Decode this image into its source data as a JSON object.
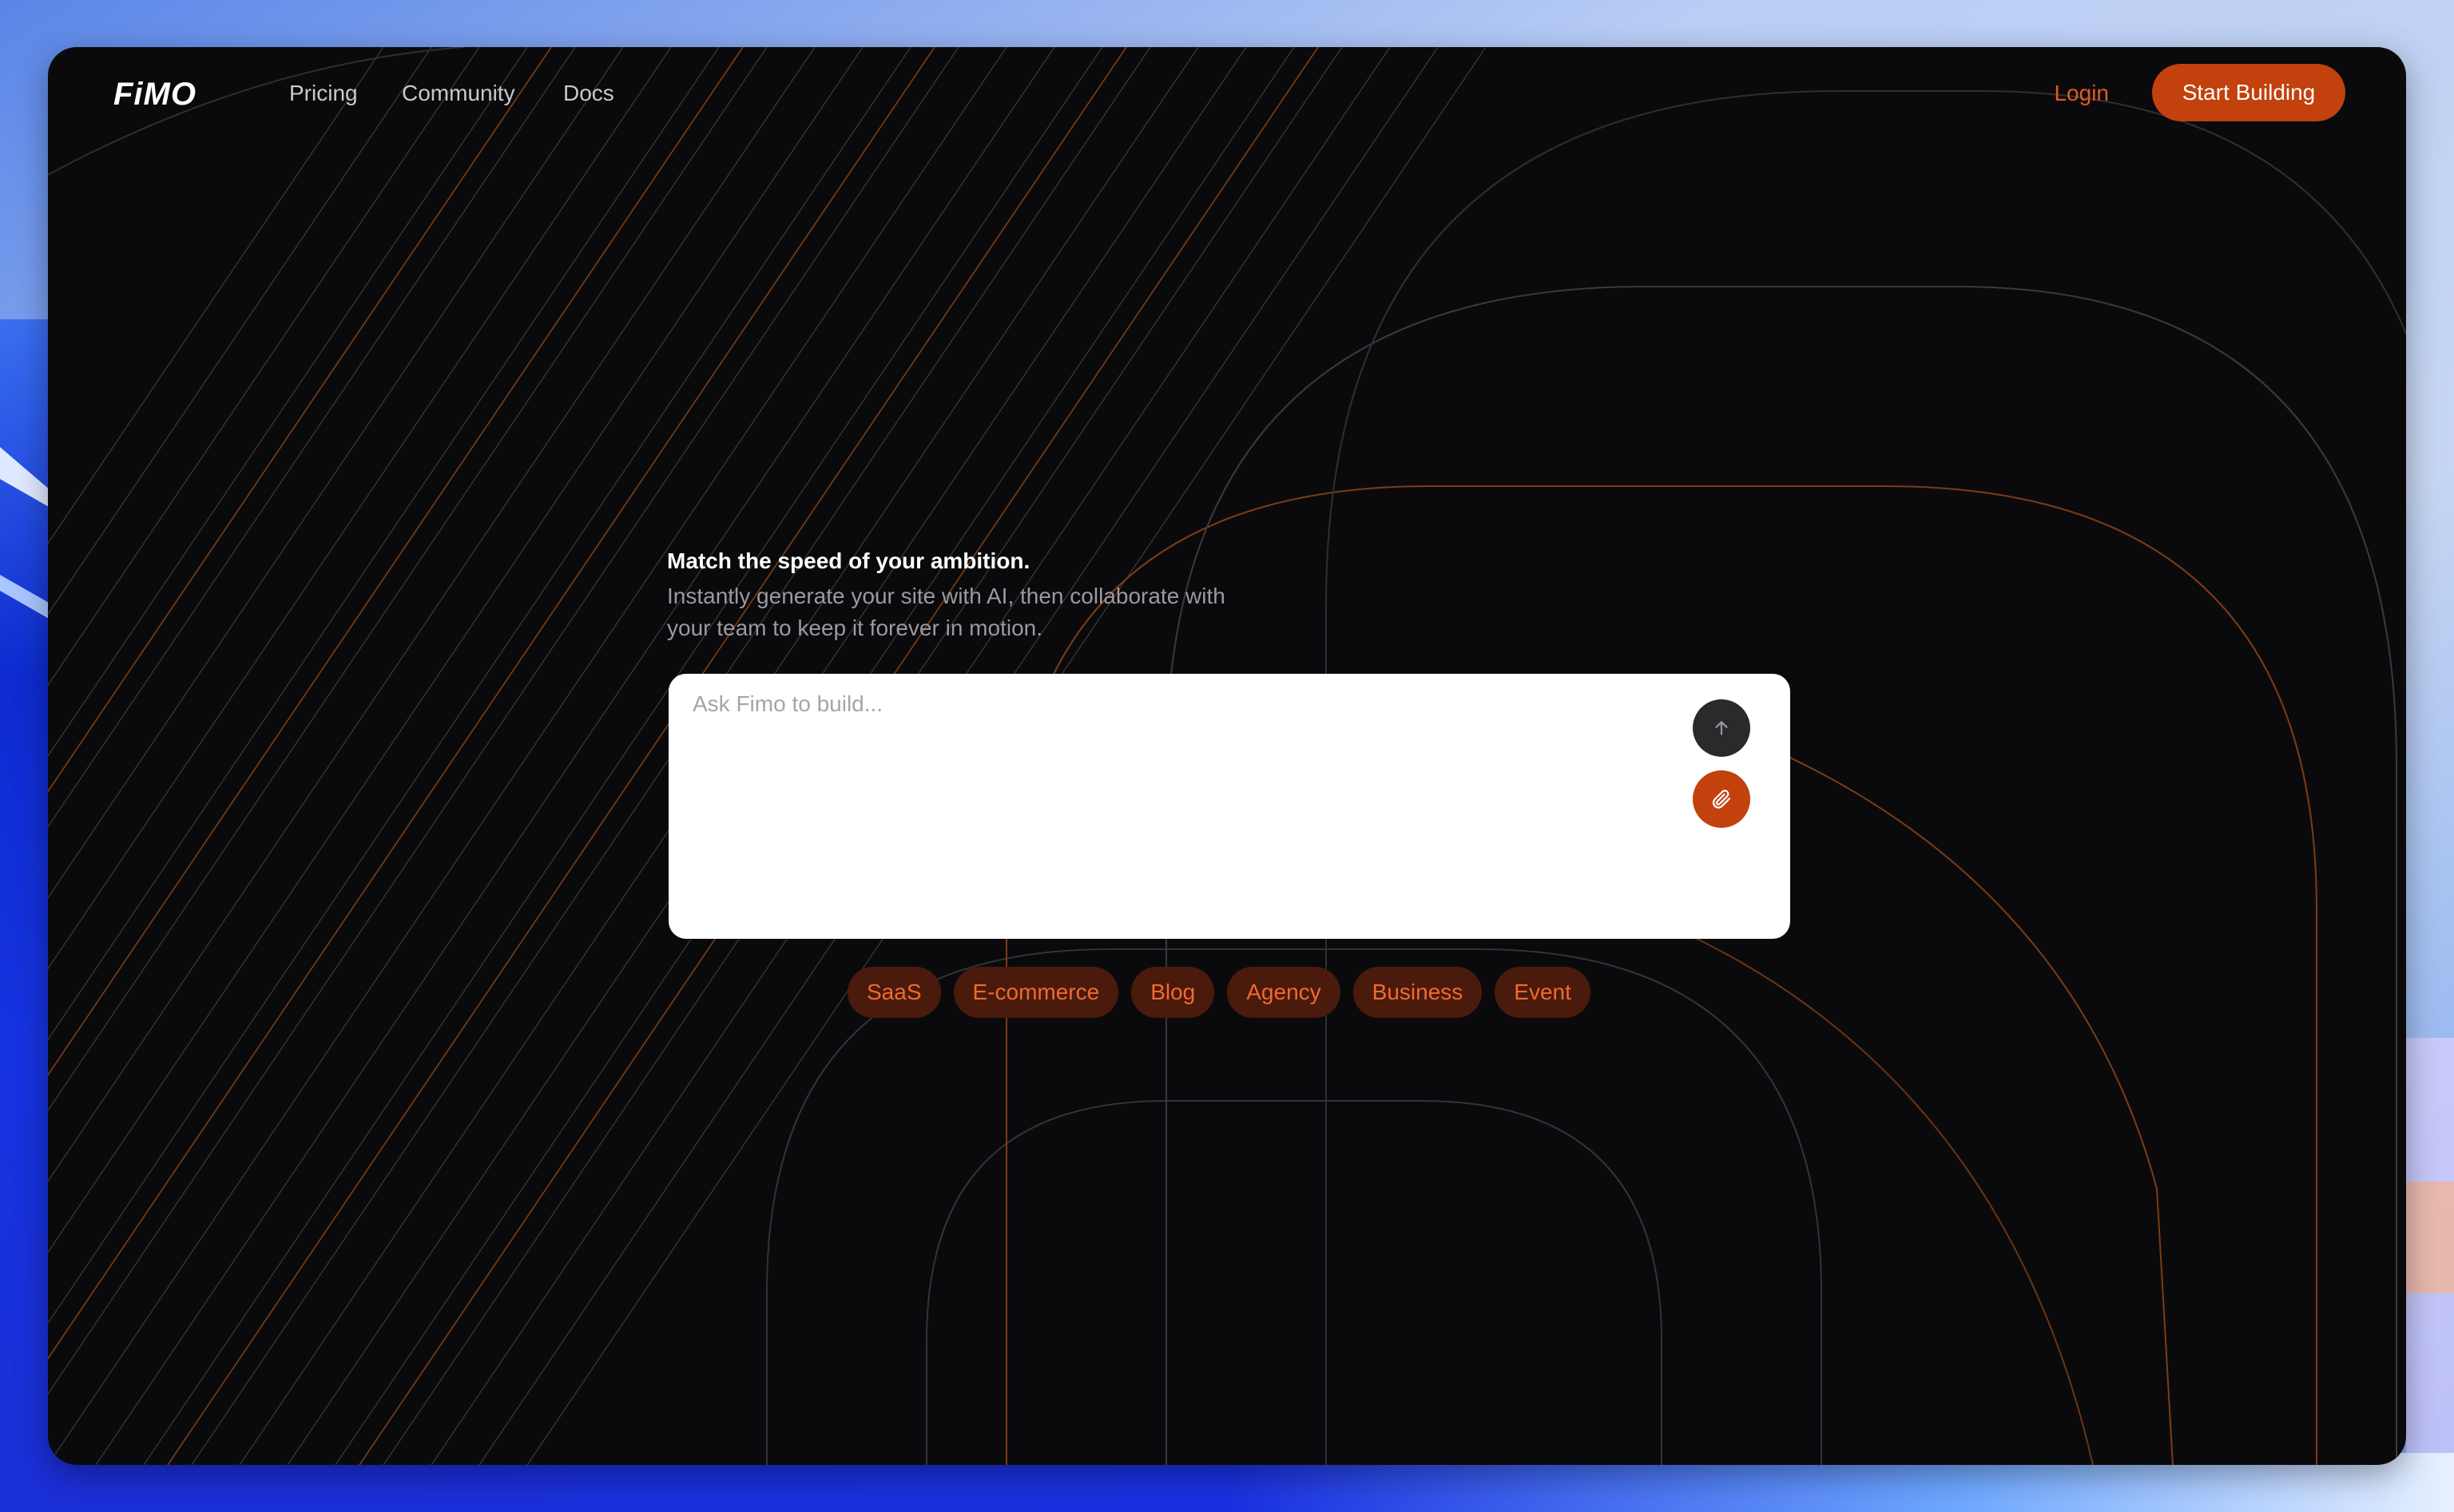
{
  "brand": {
    "logo_text": "FiMO"
  },
  "nav": {
    "links": [
      {
        "label": "Pricing"
      },
      {
        "label": "Community"
      },
      {
        "label": "Docs"
      }
    ],
    "login_label": "Login",
    "cta_label": "Start Building"
  },
  "hero": {
    "title": "Match the speed of your ambition.",
    "subtitle": "Instantly generate your site with AI, then collaborate with your team to keep it forever in motion."
  },
  "prompt": {
    "placeholder": "Ask Fimo to build...",
    "value": "",
    "send_icon": "arrow-up-icon",
    "attach_icon": "paperclip-icon"
  },
  "categories": [
    {
      "label": "SaaS"
    },
    {
      "label": "E-commerce"
    },
    {
      "label": "Blog"
    },
    {
      "label": "Agency"
    },
    {
      "label": "Business"
    },
    {
      "label": "Event"
    }
  ],
  "colors": {
    "accent": "#c2410c",
    "accent_text": "#f26a2b",
    "chip_bg": "#4a1a0d",
    "window_bg": "#0a0a0c",
    "nav_text": "#c9c9cc"
  }
}
